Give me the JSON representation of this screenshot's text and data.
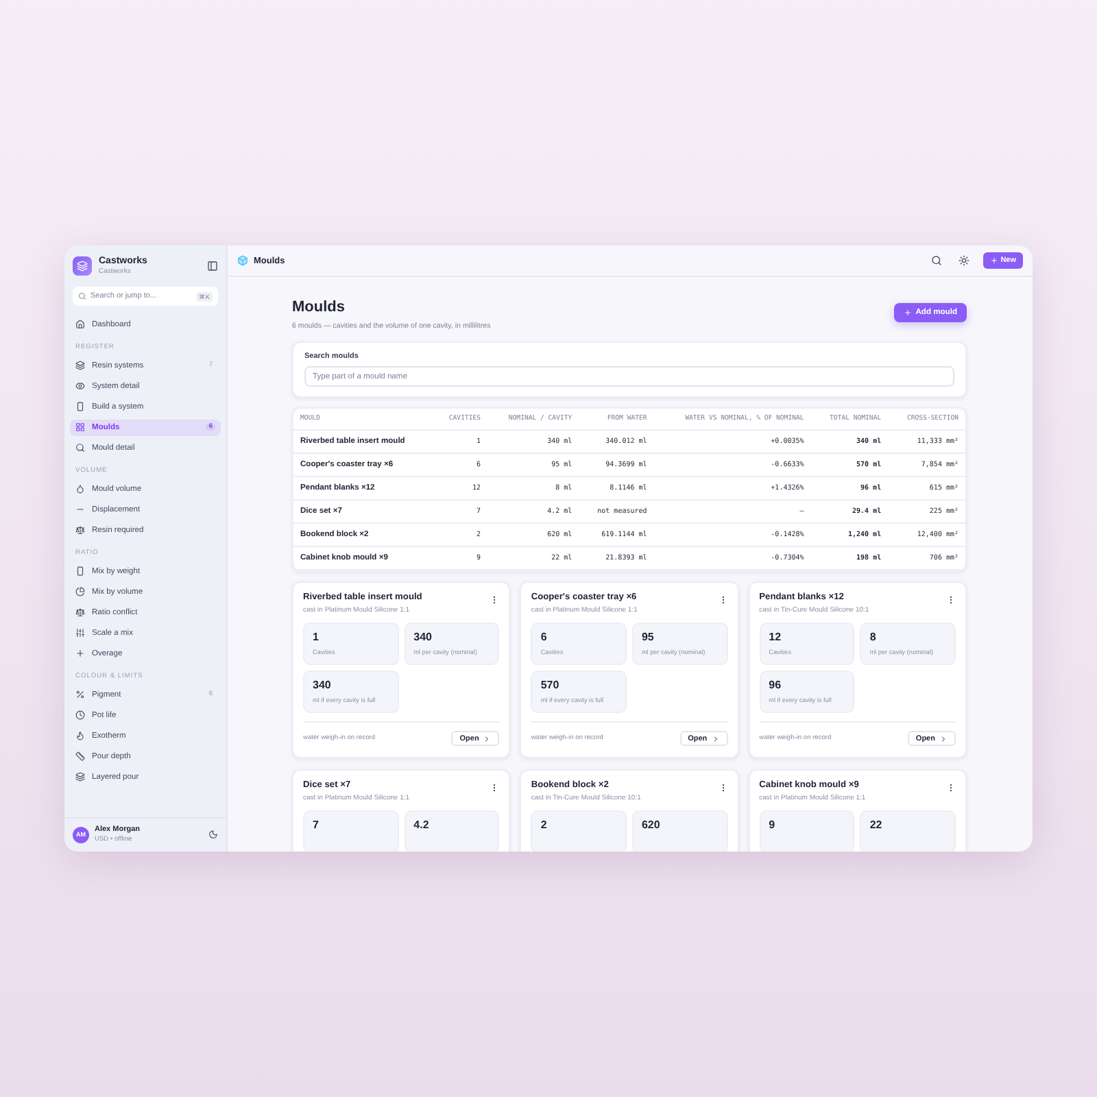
{
  "sidebar": {
    "brand": {
      "name": "Castworks",
      "subtitle": "Castworks"
    },
    "search": {
      "placeholder": "Search or jump to...",
      "shortcut": "⌘K"
    },
    "sections": [
      {
        "items": [
          {
            "label": "Dashboard",
            "selected": false
          }
        ]
      },
      {
        "label": "REGISTER",
        "items": [
          {
            "label": "Resin systems",
            "count": "7",
            "selected": false
          },
          {
            "label": "System detail",
            "selected": false
          },
          {
            "label": "Build a system",
            "selected": false
          },
          {
            "label": "Moulds",
            "count": "6",
            "selected": true
          },
          {
            "label": "Mould detail",
            "selected": false
          }
        ]
      },
      {
        "label": "VOLUME",
        "items": [
          {
            "label": "Mould volume",
            "selected": false
          },
          {
            "label": "Displacement",
            "selected": false
          },
          {
            "label": "Resin required",
            "selected": false
          }
        ]
      },
      {
        "label": "RATIO",
        "items": [
          {
            "label": "Mix by weight",
            "selected": false
          },
          {
            "label": "Mix by volume",
            "selected": false
          },
          {
            "label": "Ratio conflict",
            "selected": false
          },
          {
            "label": "Scale a mix",
            "selected": false
          },
          {
            "label": "Overage",
            "selected": false
          }
        ]
      },
      {
        "label": "COLOUR & LIMITS",
        "items": [
          {
            "label": "Pigment",
            "count": "6",
            "selected": false
          },
          {
            "label": "Pot life",
            "selected": false
          },
          {
            "label": "Exotherm",
            "selected": false
          },
          {
            "label": "Pour depth",
            "selected": false
          },
          {
            "label": "Layered pour",
            "selected": false
          }
        ]
      }
    ],
    "user": {
      "initials": "AM",
      "name": "Alex Morgan",
      "status": "USD • offline"
    }
  },
  "header": {
    "title": "Moulds",
    "new_button": "New"
  },
  "page": {
    "title": "Moulds",
    "subtitle": "6 moulds — cavities and the volume of one cavity, in millilitres",
    "add_button": "Add mould"
  },
  "search": {
    "label": "Search moulds",
    "placeholder": "Type part of a mould name"
  },
  "table": {
    "columns": [
      "MOULD",
      "CAVITIES",
      "NOMINAL / CAVITY",
      "FROM WATER",
      "WATER VS NOMINAL, % OF NOMINAL",
      "TOTAL NOMINAL",
      "CROSS-SECTION"
    ],
    "rows": [
      [
        "Riverbed table insert mould",
        "1",
        "340 ml",
        "340.012 ml",
        "+0.0035%",
        "340 ml",
        "11,333 mm²"
      ],
      [
        "Cooper's coaster tray ×6",
        "6",
        "95 ml",
        "94.3699 ml",
        "-0.6633%",
        "570 ml",
        "7,854 mm²"
      ],
      [
        "Pendant blanks ×12",
        "12",
        "8 ml",
        "8.1146 ml",
        "+1.4326%",
        "96 ml",
        "615 mm²"
      ],
      [
        "Dice set ×7",
        "7",
        "4.2 ml",
        "not measured",
        "–",
        "29.4 ml",
        "225 mm²"
      ],
      [
        "Bookend block ×2",
        "2",
        "620 ml",
        "619.1144 ml",
        "-0.1428%",
        "1,240 ml",
        "12,400 mm²"
      ],
      [
        "Cabinet knob mould ×9",
        "9",
        "22 ml",
        "21.8393 ml",
        "-0.7304%",
        "198 ml",
        "706 mm²"
      ]
    ]
  },
  "cards": [
    {
      "title": "Riverbed table insert mould",
      "subtitle": "cast in Platinum Mould Silicone 1:1",
      "stats": [
        {
          "value": "1",
          "label": "Cavities"
        },
        {
          "value": "340",
          "label": "ml per cavity (nominal)"
        },
        {
          "value": "340",
          "label": "ml if every cavity is full"
        }
      ],
      "note": "water weigh-in on record",
      "open": "Open"
    },
    {
      "title": "Cooper's coaster tray ×6",
      "subtitle": "cast in Platinum Mould Silicone 1:1",
      "stats": [
        {
          "value": "6",
          "label": "Cavities"
        },
        {
          "value": "95",
          "label": "ml per cavity (nominal)"
        },
        {
          "value": "570",
          "label": "ml if every cavity is full"
        }
      ],
      "note": "water weigh-in on record",
      "open": "Open"
    },
    {
      "title": "Pendant blanks ×12",
      "subtitle": "cast in Tin-Cure Mould Silicone 10:1",
      "stats": [
        {
          "value": "12",
          "label": "Cavities"
        },
        {
          "value": "8",
          "label": "ml per cavity (nominal)"
        },
        {
          "value": "96",
          "label": "ml if every cavity is full"
        }
      ],
      "note": "water weigh-in on record",
      "open": "Open"
    },
    {
      "title": "Dice set ×7",
      "subtitle": "cast in Platinum Mould Silicone 1:1",
      "stats": [
        {
          "value": "7"
        },
        {
          "value": "4.2"
        }
      ]
    },
    {
      "title": "Bookend block ×2",
      "subtitle": "cast in Tin-Cure Mould Silicone 10:1",
      "stats": [
        {
          "value": "2"
        },
        {
          "value": "620"
        }
      ]
    },
    {
      "title": "Cabinet knob mould ×9",
      "subtitle": "cast in Platinum Mould Silicone 1:1",
      "stats": [
        {
          "value": "9"
        },
        {
          "value": "22"
        }
      ]
    }
  ]
}
